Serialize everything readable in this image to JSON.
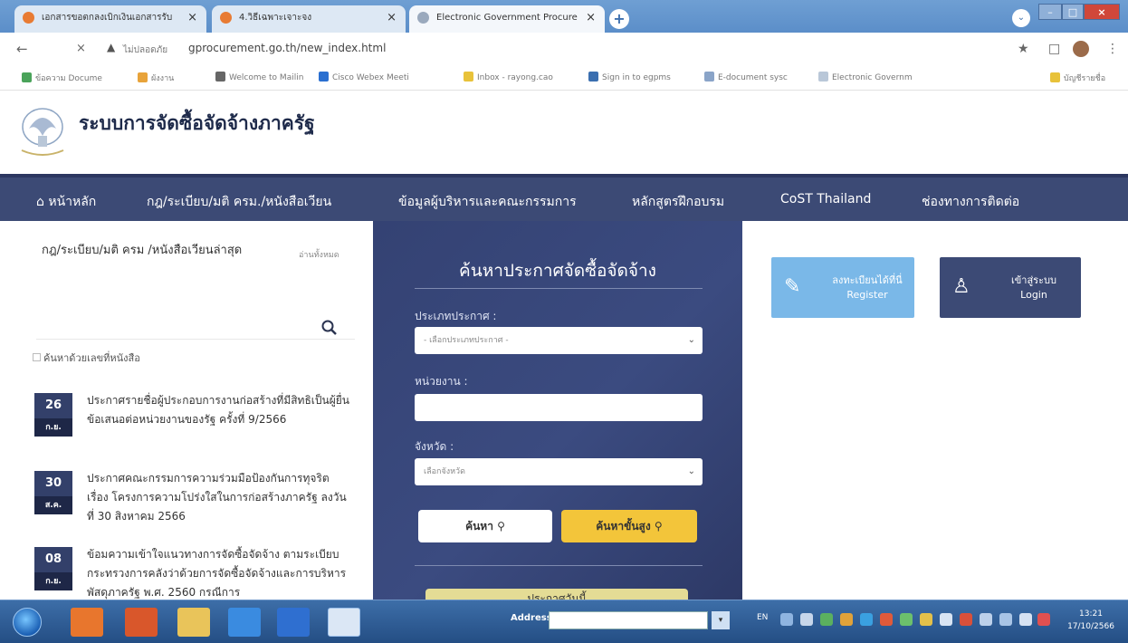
{
  "browser": {
    "tabs": [
      {
        "title": "เอกสารขอตกลงเบิกเงินเอกสารรับ",
        "close": "×"
      },
      {
        "title": "4.วิธีเฉพาะเจาะจง",
        "close": "×"
      },
      {
        "title": "Electronic Government Procure",
        "close": "×"
      }
    ],
    "new_tab": "+",
    "address": {
      "back": "←",
      "stop": "×",
      "warning": "▲",
      "not_secure": "ไม่ปลอดภัย",
      "url": "gprocurement.go.th/new_index.html"
    },
    "bookmarks": [
      "ข้อความ Docume",
      "ผังงาน",
      "Welcome to Mailin",
      "Cisco Webex Meeti",
      "Inbox - rayong.cao",
      "Sign in to egpms",
      "E-document sysc",
      "Electronic Governm",
      "บัญชีรายชื่อ"
    ],
    "colors": {
      "tab_strip": "#5b8ec9"
    }
  },
  "site": {
    "title": "ระบบการจัดซื้อจัดจ้างภาครัฐ",
    "nav": [
      {
        "label": "หน้าหลัก",
        "icon": "home-icon"
      },
      {
        "label": "กฎ/ระเบียบ/มติ ครม./หนังสือเวียน"
      },
      {
        "label": "ข้อมูลผู้บริหารและคณะกรรมการ"
      },
      {
        "label": "หลักสูตรฝึกอบรม"
      },
      {
        "label": "CoST Thailand"
      },
      {
        "label": "ช่องทางการติดต่อ"
      }
    ],
    "colors": {
      "nav": "#3c4a75",
      "accent_yellow": "#f3c53a",
      "register_blue": "#7ab8e8"
    }
  },
  "left": {
    "section_title": "กฎ/ระเบียบ/มติ ครม /หนังสือเวียนล่าสุด",
    "read_all": "อ่านทั้งหมด",
    "search_by_doc_no": "ค้นหาด้วยเลขที่หนังสือ",
    "news": [
      {
        "day": "26",
        "month": "ก.ย.",
        "text": "ประกาศรายชื่อผู้ประกอบการงานก่อสร้างที่มีสิทธิเป็นผู้ยื่นข้อเสนอต่อหน่วยงานของรัฐ ครั้งที่ 9/2566"
      },
      {
        "day": "30",
        "month": "ส.ค.",
        "text": "ประกาศคณะกรรมการความร่วมมือป้องกันการทุจริต เรื่อง โครงการความโปร่งใสในการก่อสร้างภาครัฐ ลงวันที่ 30 สิงหาคม 2566"
      },
      {
        "day": "08",
        "month": "ก.ย.",
        "text": "ข้อมความเข้าใจแนวทางการจัดซื้อจัดจ้าง ตามระเบียบกระทรวงการคลังว่าด้วยการจัดซื้อจัดจ้างและการบริหารพัสดุภาครัฐ พ.ศ. 2560 กรณีการ"
      }
    ]
  },
  "search_panel": {
    "title": "ค้นหาประกาศจัดซื้อจัดจ้าง",
    "announce_type_label": "ประเภทประกาศ :",
    "announce_type_placeholder": "- เลือกประเภทประกาศ -",
    "agency_label": "หน่วยงาน :",
    "agency_value": "",
    "province_label": "จังหวัด :",
    "province_placeholder": "เลือกจังหวัด",
    "search_button": "ค้นหา",
    "advanced_button": "ค้นหาขั้นสูง",
    "today_button": "ประกาศวันนี้"
  },
  "right": {
    "register_line1": "ลงทะเบียนได้ที่นี่",
    "register_line2": "Register",
    "login_line1": "เข้าสู่ระบบ",
    "login_line2": "Login"
  },
  "taskbar": {
    "address_label": "Address",
    "address_go": "▾",
    "lang": "EN",
    "time": "13:21",
    "date": "17/10/2566"
  }
}
